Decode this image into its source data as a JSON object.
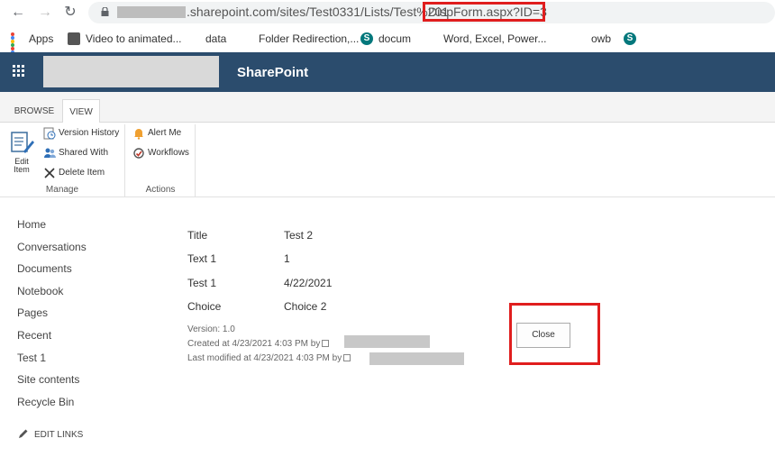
{
  "browser": {
    "url_visible": ".sharepoint.com/sites/Test0331/Lists/Test%201",
    "url_highlighted": "DispForm.aspx?ID=3",
    "bookmarks": [
      {
        "label": "Apps",
        "icon": "apps-grid-icon"
      },
      {
        "label": "Video to animated...",
        "icon": "video-icon"
      },
      {
        "label": "data",
        "icon": "microsoft-icon"
      },
      {
        "label": "Folder Redirection,...",
        "icon": "microsoft-icon"
      },
      {
        "label": "docum",
        "icon": "sharepoint-icon"
      },
      {
        "label": "Word, Excel, Power...",
        "icon": "microsoft-icon"
      },
      {
        "label": "",
        "icon": "microsoft-icon"
      },
      {
        "label": "owb",
        "icon": "microsoft-icon"
      },
      {
        "label": "",
        "icon": "sharepoint-icon"
      }
    ]
  },
  "suite": {
    "title": "SharePoint",
    "bar_color": "#2b4c6d"
  },
  "ribbon": {
    "tabs": [
      "BROWSE",
      "VIEW"
    ],
    "active_tab": "VIEW",
    "edit_item_line1": "Edit",
    "edit_item_line2": "Item",
    "manage_items": [
      "Version History",
      "Shared With",
      "Delete Item"
    ],
    "actions_items": [
      "Alert Me",
      "Workflows"
    ],
    "group_manage": "Manage",
    "group_actions": "Actions"
  },
  "leftnav": {
    "items": [
      "Home",
      "Conversations",
      "Documents",
      "Notebook",
      "Pages",
      "Recent",
      "Test 1",
      "Site contents",
      "Recycle Bin"
    ],
    "edit_links": "EDIT LINKS"
  },
  "form": {
    "fields": [
      {
        "label": "Title",
        "value": "Test 2"
      },
      {
        "label": "Text 1",
        "value": "1"
      },
      {
        "label": "Test 1",
        "value": "4/22/2021"
      },
      {
        "label": "Choice",
        "value": "Choice 2"
      }
    ],
    "version": "Version: 1.0",
    "created": "Created at 4/23/2021 4:03 PM  by",
    "modified": "Last modified at 4/23/2021 4:03 PM  by",
    "close_label": "Close"
  },
  "colors": {
    "highlight": "#e01e1e"
  }
}
